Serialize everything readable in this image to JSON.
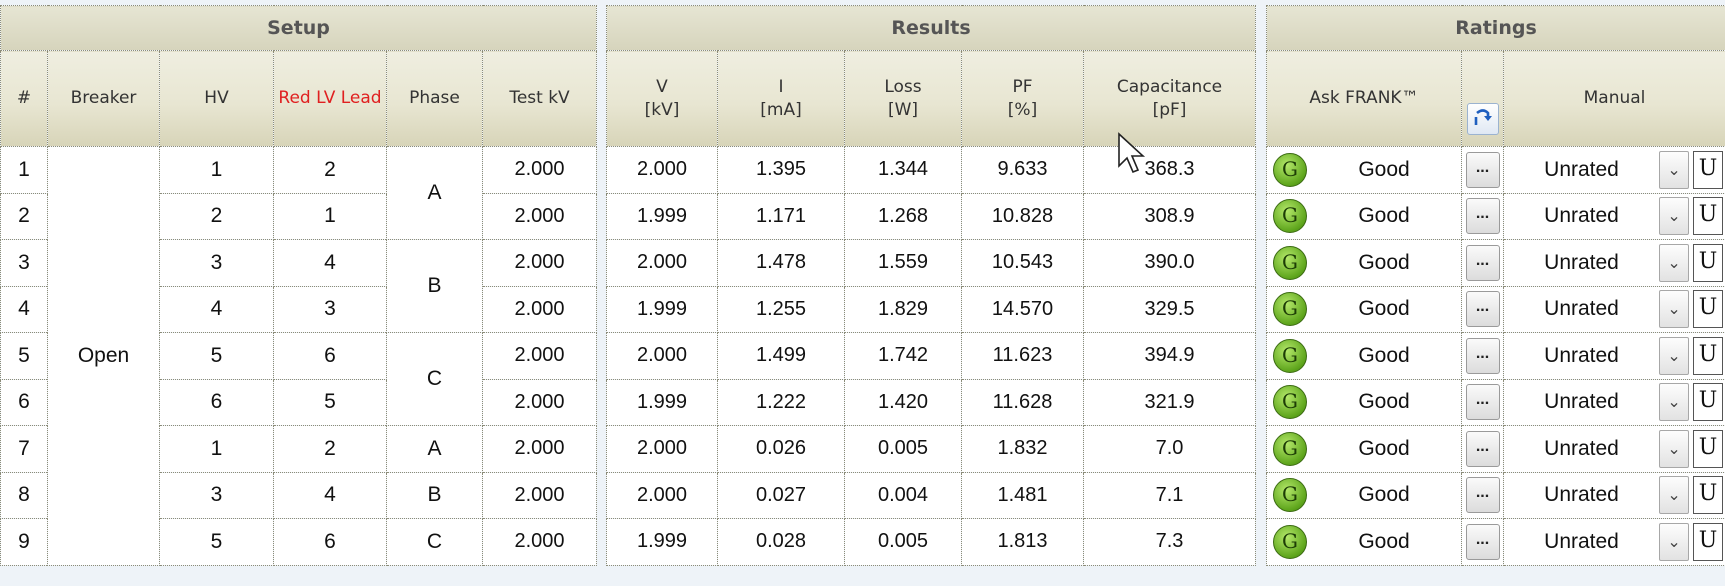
{
  "setup": {
    "title": "Setup",
    "headers": {
      "index": "#",
      "breaker": "Breaker",
      "hv": "HV",
      "red_lv_lead": "Red LV Lead",
      "phase": "Phase",
      "test_kv": "Test kV"
    },
    "breaker_state": "Open",
    "rows": [
      {
        "index": "1",
        "hv": "1",
        "lv": "2",
        "phase": "A",
        "test_kv": "2.000"
      },
      {
        "index": "2",
        "hv": "2",
        "lv": "1",
        "phase": "A",
        "test_kv": "2.000"
      },
      {
        "index": "3",
        "hv": "3",
        "lv": "4",
        "phase": "B",
        "test_kv": "2.000"
      },
      {
        "index": "4",
        "hv": "4",
        "lv": "3",
        "phase": "B",
        "test_kv": "2.000"
      },
      {
        "index": "5",
        "hv": "5",
        "lv": "6",
        "phase": "C",
        "test_kv": "2.000"
      },
      {
        "index": "6",
        "hv": "6",
        "lv": "5",
        "phase": "C",
        "test_kv": "2.000"
      },
      {
        "index": "7",
        "hv": "1",
        "lv": "2",
        "phase": "A",
        "test_kv": "2.000"
      },
      {
        "index": "8",
        "hv": "3",
        "lv": "4",
        "phase": "B",
        "test_kv": "2.000"
      },
      {
        "index": "9",
        "hv": "5",
        "lv": "6",
        "phase": "C",
        "test_kv": "2.000"
      }
    ]
  },
  "results": {
    "title": "Results",
    "headers": {
      "v": "V",
      "v_unit": "[kV]",
      "i": "I",
      "i_unit": "[mA]",
      "loss": "Loss",
      "loss_unit": "[W]",
      "pf": "PF",
      "pf_unit": "[%]",
      "cap": "Capacitance",
      "cap_unit": "[pF]"
    },
    "rows": [
      {
        "v": "2.000",
        "i": "1.395",
        "loss": "1.344",
        "pf": "9.633",
        "cap": "368.3"
      },
      {
        "v": "1.999",
        "i": "1.171",
        "loss": "1.268",
        "pf": "10.828",
        "cap": "308.9"
      },
      {
        "v": "2.000",
        "i": "1.478",
        "loss": "1.559",
        "pf": "10.543",
        "cap": "390.0"
      },
      {
        "v": "1.999",
        "i": "1.255",
        "loss": "1.829",
        "pf": "14.570",
        "cap": "329.5"
      },
      {
        "v": "2.000",
        "i": "1.499",
        "loss": "1.742",
        "pf": "11.623",
        "cap": "394.9"
      },
      {
        "v": "1.999",
        "i": "1.222",
        "loss": "1.420",
        "pf": "11.628",
        "cap": "321.9"
      },
      {
        "v": "2.000",
        "i": "0.026",
        "loss": "0.005",
        "pf": "1.832",
        "cap": "7.0"
      },
      {
        "v": "2.000",
        "i": "0.027",
        "loss": "0.004",
        "pf": "1.481",
        "cap": "7.1"
      },
      {
        "v": "1.999",
        "i": "0.028",
        "loss": "0.005",
        "pf": "1.813",
        "cap": "7.3"
      }
    ]
  },
  "ratings": {
    "title": "Ratings",
    "headers": {
      "ask_frank": "Ask FRANK™",
      "manual": "Manual"
    },
    "indicator_letter": "G",
    "indicator_color": "#6cb427",
    "more_label": "...",
    "dropdown_glyph": "⌄",
    "u_label": "U",
    "refresh_icon": "refresh-icon",
    "rows": [
      {
        "ask": "Good",
        "manual": "Unrated"
      },
      {
        "ask": "Good",
        "manual": "Unrated"
      },
      {
        "ask": "Good",
        "manual": "Unrated"
      },
      {
        "ask": "Good",
        "manual": "Unrated"
      },
      {
        "ask": "Good",
        "manual": "Unrated"
      },
      {
        "ask": "Good",
        "manual": "Unrated"
      },
      {
        "ask": "Good",
        "manual": "Unrated"
      },
      {
        "ask": "Good",
        "manual": "Unrated"
      },
      {
        "ask": "Good",
        "manual": "Unrated"
      }
    ]
  }
}
